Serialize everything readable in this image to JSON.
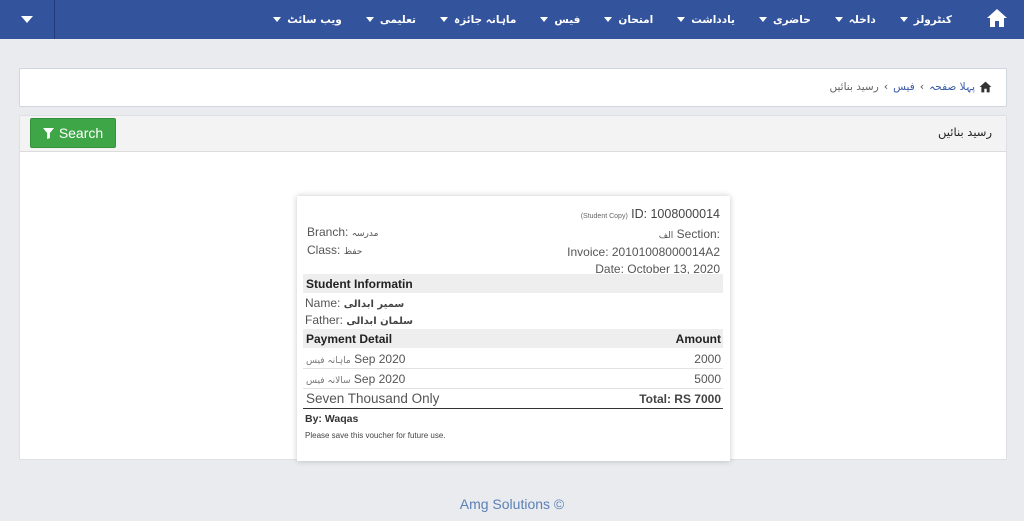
{
  "nav": {
    "menu_items": [
      "کنٹرولز",
      "داخلہ",
      "حاضری",
      "یادداشت",
      "امتحان",
      "فیس",
      "ماہانہ جائزہ",
      "تعلیمی",
      "ویب سائٹ"
    ],
    "brand_color": "#33539d"
  },
  "breadcrumb": {
    "home": "پہلا صفحہ",
    "fees": "فیس",
    "current": "رسید بنائیں"
  },
  "panel": {
    "title": "رسید بنائیں",
    "search_label": "Search"
  },
  "receipt": {
    "copy_label": "(Student Copy)",
    "id_label": "ID:",
    "id_value": "1008000014",
    "branch_label": "Branch:",
    "branch_value": "مدرسہ",
    "class_label": "Class:",
    "class_value": "حفظ",
    "section_label": "Section:",
    "section_value": "الف",
    "invoice_label": "Invoice:",
    "invoice_value": "20101008000014A2",
    "date_label": "Date:",
    "date_value": "October 13, 2020",
    "student_heading": "Student Informatin",
    "name_label": "Name:",
    "name_value": "سمیر ابدالی",
    "father_label": "Father:",
    "father_value": "سلمان ابدالی",
    "payment_heading": "Payment Detail",
    "amount_heading": "Amount",
    "payments": [
      {
        "fee_type": "ماہانہ فیس",
        "period": "Sep 2020",
        "amount": "2000"
      },
      {
        "fee_type": "سالانہ فیس",
        "period": "Sep 2020",
        "amount": "5000"
      }
    ],
    "total_words": "Seven Thousand Only",
    "total_label": "Total: RS 7000",
    "by_label": "By: Waqas",
    "note": "Please save this voucher for future use."
  },
  "footer": {
    "text": "Amg Solutions ©"
  }
}
